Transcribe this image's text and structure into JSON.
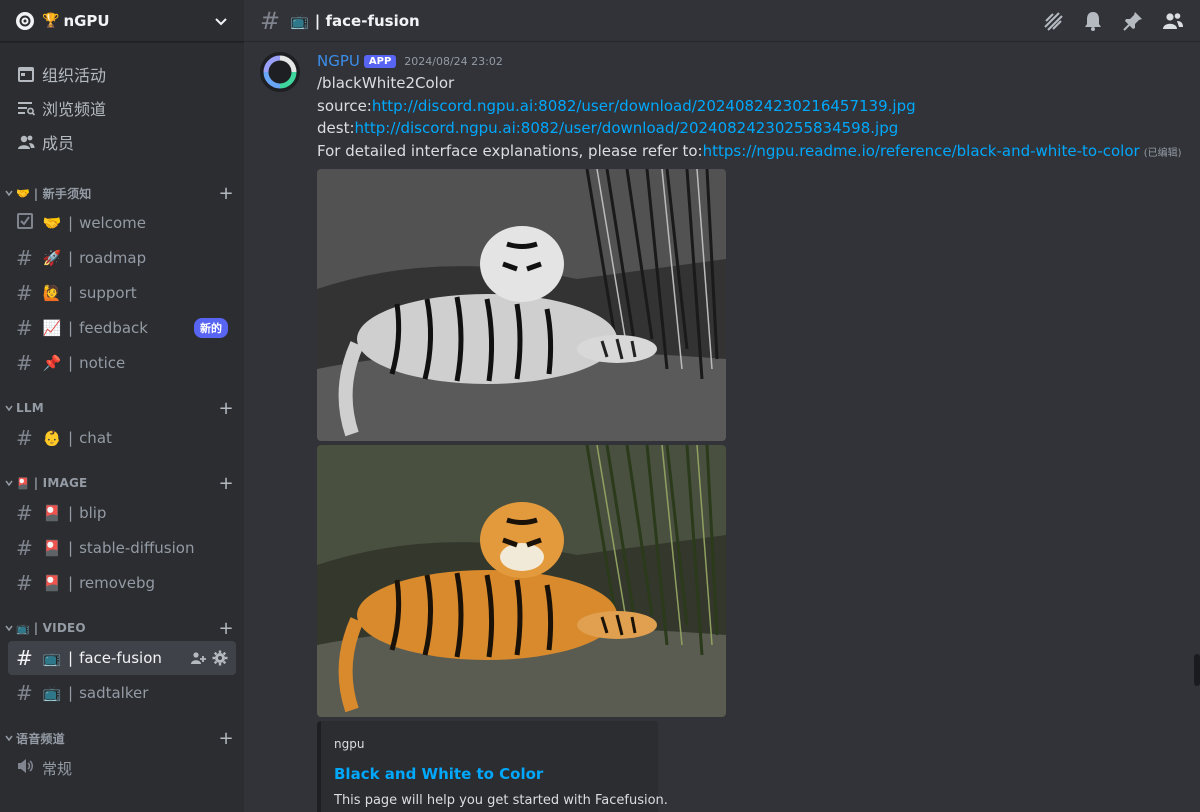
{
  "server": {
    "name": "nGPU",
    "trophy_emoji": "🏆"
  },
  "nav": [
    {
      "label": "组织活动",
      "icon": "calendar-icon"
    },
    {
      "label": "浏览频道",
      "icon": "browse-channels-icon"
    },
    {
      "label": "成员",
      "icon": "members-icon"
    }
  ],
  "categories": {
    "newbie": {
      "emoji": "🤝",
      "label": "| 新手须知"
    },
    "llm": {
      "label": "LLM"
    },
    "image": {
      "emoji": "🎴",
      "label": "| IMAGE"
    },
    "video": {
      "emoji": "📺",
      "label": "| VIDEO"
    },
    "voice": {
      "label": "语音频道"
    }
  },
  "channels": {
    "welcome": {
      "emoji": "🤝",
      "name": "welcome"
    },
    "roadmap": {
      "emoji": "🚀",
      "name": "roadmap"
    },
    "support": {
      "emoji": "🙋",
      "name": "support"
    },
    "feedback": {
      "emoji": "📈",
      "name": "feedback",
      "badge": "新的"
    },
    "notice": {
      "emoji": "📌",
      "name": "notice"
    },
    "chat": {
      "emoji": "👶",
      "name": "chat"
    },
    "blip": {
      "emoji": "🎴",
      "name": "blip"
    },
    "stable_diffusion": {
      "emoji": "🎴",
      "name": "stable-diffusion"
    },
    "removebg": {
      "emoji": "🎴",
      "name": "removebg"
    },
    "face_fusion": {
      "emoji": "📺",
      "name": "face-fusion"
    },
    "sadtalker": {
      "emoji": "📺",
      "name": "sadtalker"
    },
    "voice_general": {
      "name": "常规"
    }
  },
  "separator": "|",
  "header": {
    "emoji": "📺",
    "separator": "|",
    "title": "face-fusion"
  },
  "message": {
    "author": "NGPU",
    "badge": "APP",
    "timestamp": "2024/08/24 23:02",
    "command": "/blackWhite2Color",
    "source_label": "source:",
    "source_url": "http://discord.ngpu.ai:8082/user/download/20240824230216457139.jpg",
    "dest_label": "dest:",
    "dest_url": "http://discord.ngpu.ai:8082/user/download/20240824230255834598.jpg",
    "refer_text": "For detailed interface explanations, please refer to:",
    "refer_url": "https://ngpu.readme.io/reference/black-and-white-to-color",
    "edited": "(已编辑)"
  },
  "embed": {
    "provider": "ngpu",
    "title": "Black and White to Color",
    "description": "This page will help you get started with Facefusion."
  },
  "colors": {
    "accent": "#5865f2",
    "link": "#00a8fc",
    "author": "#3b8eea"
  }
}
